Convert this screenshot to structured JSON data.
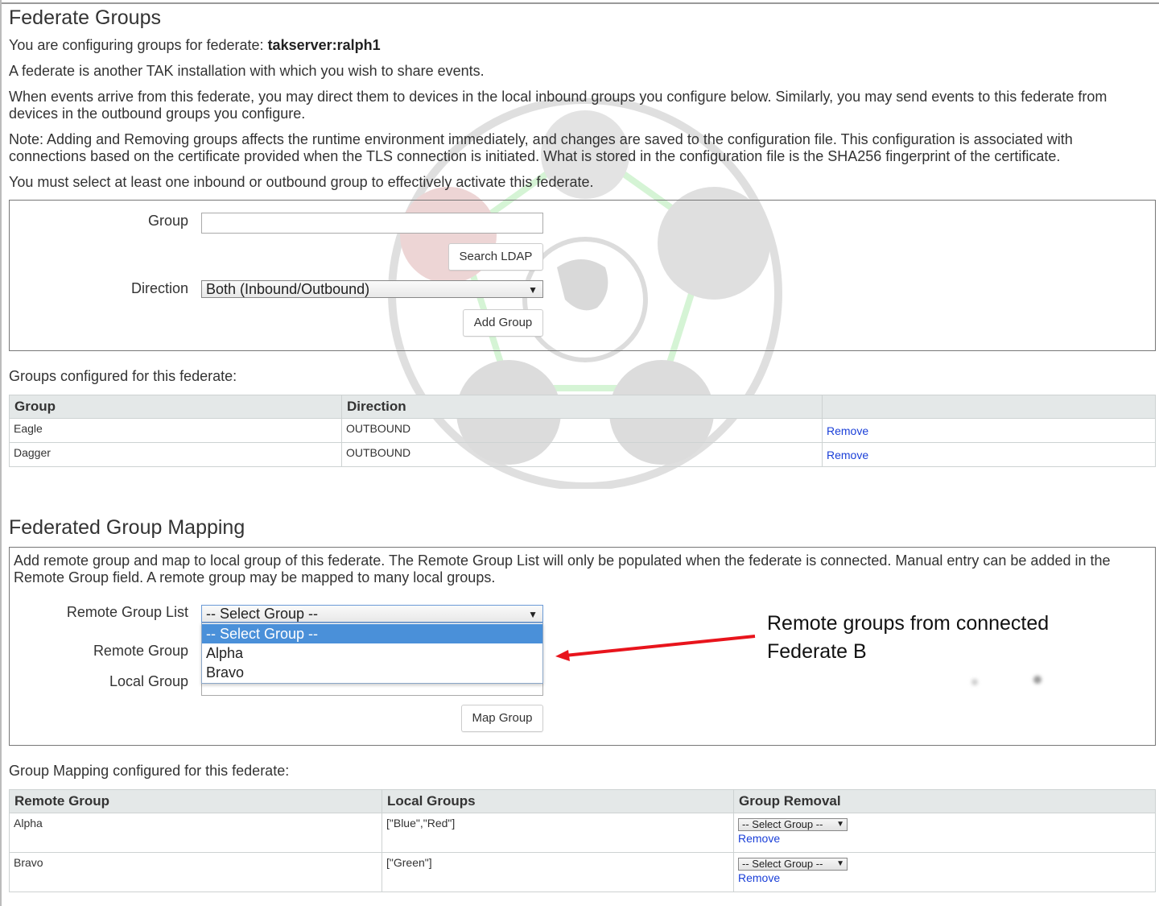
{
  "federate_groups": {
    "title": "Federate Groups",
    "configuring_prefix": "You are configuring groups for federate: ",
    "federate_name": "takserver:ralph1",
    "desc1": "A federate is another TAK installation with which you wish to share events.",
    "desc2": "When events arrive from this federate, you may direct them to devices in the local inbound groups you configure below. Similarly, you may send events to this federate from devices in the outbound groups you configure.",
    "desc3": "Note: Adding and Removing groups affects the runtime environment immediately, and changes are saved to the configuration file. This configuration is associated with connections based on the certificate provided when the TLS connection is initiated. What is stored in the configuration file is the SHA256 fingerprint of the certificate.",
    "desc4": "You must select at least one inbound or outbound group to effectively activate this federate.",
    "form": {
      "group_label": "Group",
      "group_value": "",
      "search_button": "Search LDAP",
      "direction_label": "Direction",
      "direction_value": "Both (Inbound/Outbound)",
      "add_button": "Add Group"
    },
    "configured_heading": "Groups configured for this federate:",
    "table": {
      "headers": [
        "Group",
        "Direction",
        ""
      ],
      "rows": [
        {
          "group": "Eagle",
          "direction": "OUTBOUND",
          "action": "Remove"
        },
        {
          "group": "Dagger",
          "direction": "OUTBOUND",
          "action": "Remove"
        }
      ]
    }
  },
  "mapping": {
    "title": "Federated Group Mapping",
    "desc": "Add remote group and map to local group of this federate. The Remote Group List will only be populated when the federate is connected. Manual entry can be added in the Remote Group field. A remote group may be mapped to many local groups.",
    "form": {
      "remote_list_label": "Remote Group List",
      "remote_list_value": "-- Select Group --",
      "dropdown_options": [
        "-- Select Group --",
        "Alpha",
        "Bravo"
      ],
      "remote_group_label": "Remote Group",
      "local_group_label": "Local Group",
      "map_button": "Map Group"
    },
    "configured_heading": "Group Mapping configured for this federate:",
    "table": {
      "headers": [
        "Remote Group",
        "Local Groups",
        "Group Removal"
      ],
      "rows": [
        {
          "remote": "Alpha",
          "local": "[\"Blue\",\"Red\"]",
          "select": "-- Select Group --",
          "action": "Remove"
        },
        {
          "remote": "Bravo",
          "local": "[\"Green\"]",
          "select": "-- Select Group --",
          "action": "Remove"
        }
      ]
    }
  },
  "annotation": {
    "text": "Remote groups from connected Federate B",
    "arrow_color": "#e8141c"
  },
  "colors": {
    "link": "#1a3fd8",
    "header_bg": "#e4e8e8",
    "selected_option": "#4a90d9"
  }
}
